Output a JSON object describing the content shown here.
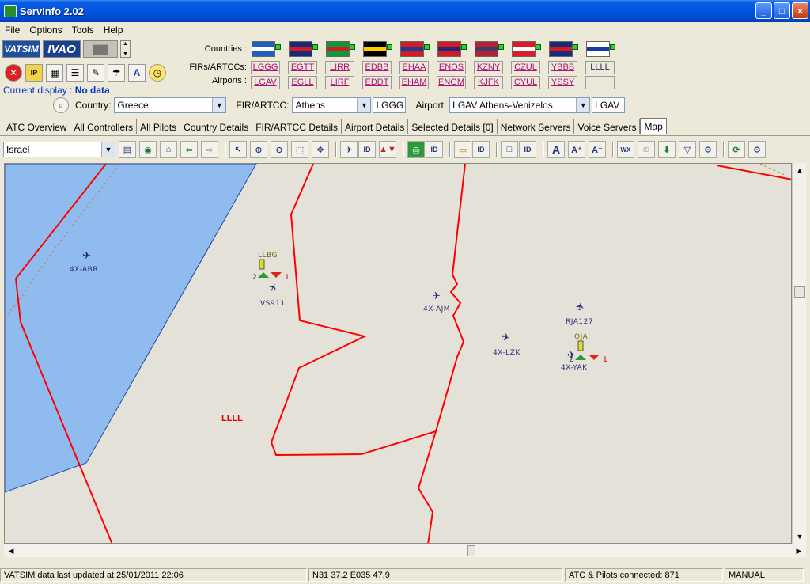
{
  "window": {
    "title": "ServInfo 2.02",
    "minimize": "_",
    "maximize": "□",
    "close": "×"
  },
  "menu": [
    "File",
    "Options",
    "Tools",
    "Help"
  ],
  "logos": {
    "vatsim": "VATSIM",
    "ivao": "IVAO"
  },
  "labels": {
    "countries": "Countries :",
    "firs": "FIRs/ARTCCs:",
    "airports": "Airports :"
  },
  "flags": [
    {
      "name": "greece-flag",
      "c1": "#1f5fbf",
      "c2": "#ffffff"
    },
    {
      "name": "uk-flag",
      "c1": "#1b2a78",
      "c2": "#d41a22"
    },
    {
      "name": "italy-flag",
      "c1": "#0a9a3a",
      "c2": "#d41a22"
    },
    {
      "name": "germany-flag",
      "c1": "#000000",
      "c2": "#ffcc00"
    },
    {
      "name": "netherlands-flag",
      "c1": "#d41a22",
      "c2": "#1b3a9a"
    },
    {
      "name": "norway-flag",
      "c1": "#d41a22",
      "c2": "#1b2a78"
    },
    {
      "name": "usa-flag",
      "c1": "#b22234",
      "c2": "#3c3b6e"
    },
    {
      "name": "canada-flag",
      "c1": "#e01a22",
      "c2": "#ffffff"
    },
    {
      "name": "australia-flag",
      "c1": "#1b2a78",
      "c2": "#d41a22"
    },
    {
      "name": "israel-flag",
      "c1": "#ffffff",
      "c2": "#1b3aa0"
    }
  ],
  "firs": [
    "LGGG",
    "EGTT",
    "LIRR",
    "EDBB",
    "EHAA",
    "ENOS",
    "KZNY",
    "CZUL",
    "YBBB",
    "LLLL"
  ],
  "airports": [
    "LGAV",
    "EGLL",
    "LIRF",
    "EDDT",
    "EHAM",
    "ENGM",
    "KJFK",
    "CYUL",
    "YSSY",
    ""
  ],
  "current_display": {
    "label": "Current display :",
    "value": "No data"
  },
  "filters": {
    "country_label": "Country:",
    "country": "Greece",
    "fir_label": "FIR/ARTCC:",
    "fir": "Athens",
    "fir_code": "LGGG",
    "airport_label": "Airport:",
    "airport": "LGAV Athens-Venizelos",
    "airport_code": "LGAV"
  },
  "tabs": [
    "ATC Overview",
    "All Controllers",
    "All Pilots",
    "Country Details",
    "FIR/ARTCC Details",
    "Airport Details",
    "Selected Details [0]",
    "Network Servers",
    "Voice Servers",
    "Map"
  ],
  "active_tab": "Map",
  "map_region": "Israel",
  "map_toolbar": {
    "id": "ID",
    "wx": "WX"
  },
  "map": {
    "fir_label": "LLLL",
    "airports": [
      {
        "code": "LLBG",
        "left": "2",
        "right": "1"
      },
      {
        "code": "OJAI",
        "left": "2",
        "right": "1"
      }
    ],
    "aircraft": [
      "4X-ABR",
      "VS911",
      "4X-AJM",
      "4X-LZK",
      "RJA127",
      "4X-YAK"
    ]
  },
  "status": {
    "updated": "VATSIM data last updated at 25/01/2011 22:06",
    "coords": "N31 37.2  E035 47.9",
    "connected": "ATC & Pilots connected: 871",
    "mode": "MANUAL"
  }
}
